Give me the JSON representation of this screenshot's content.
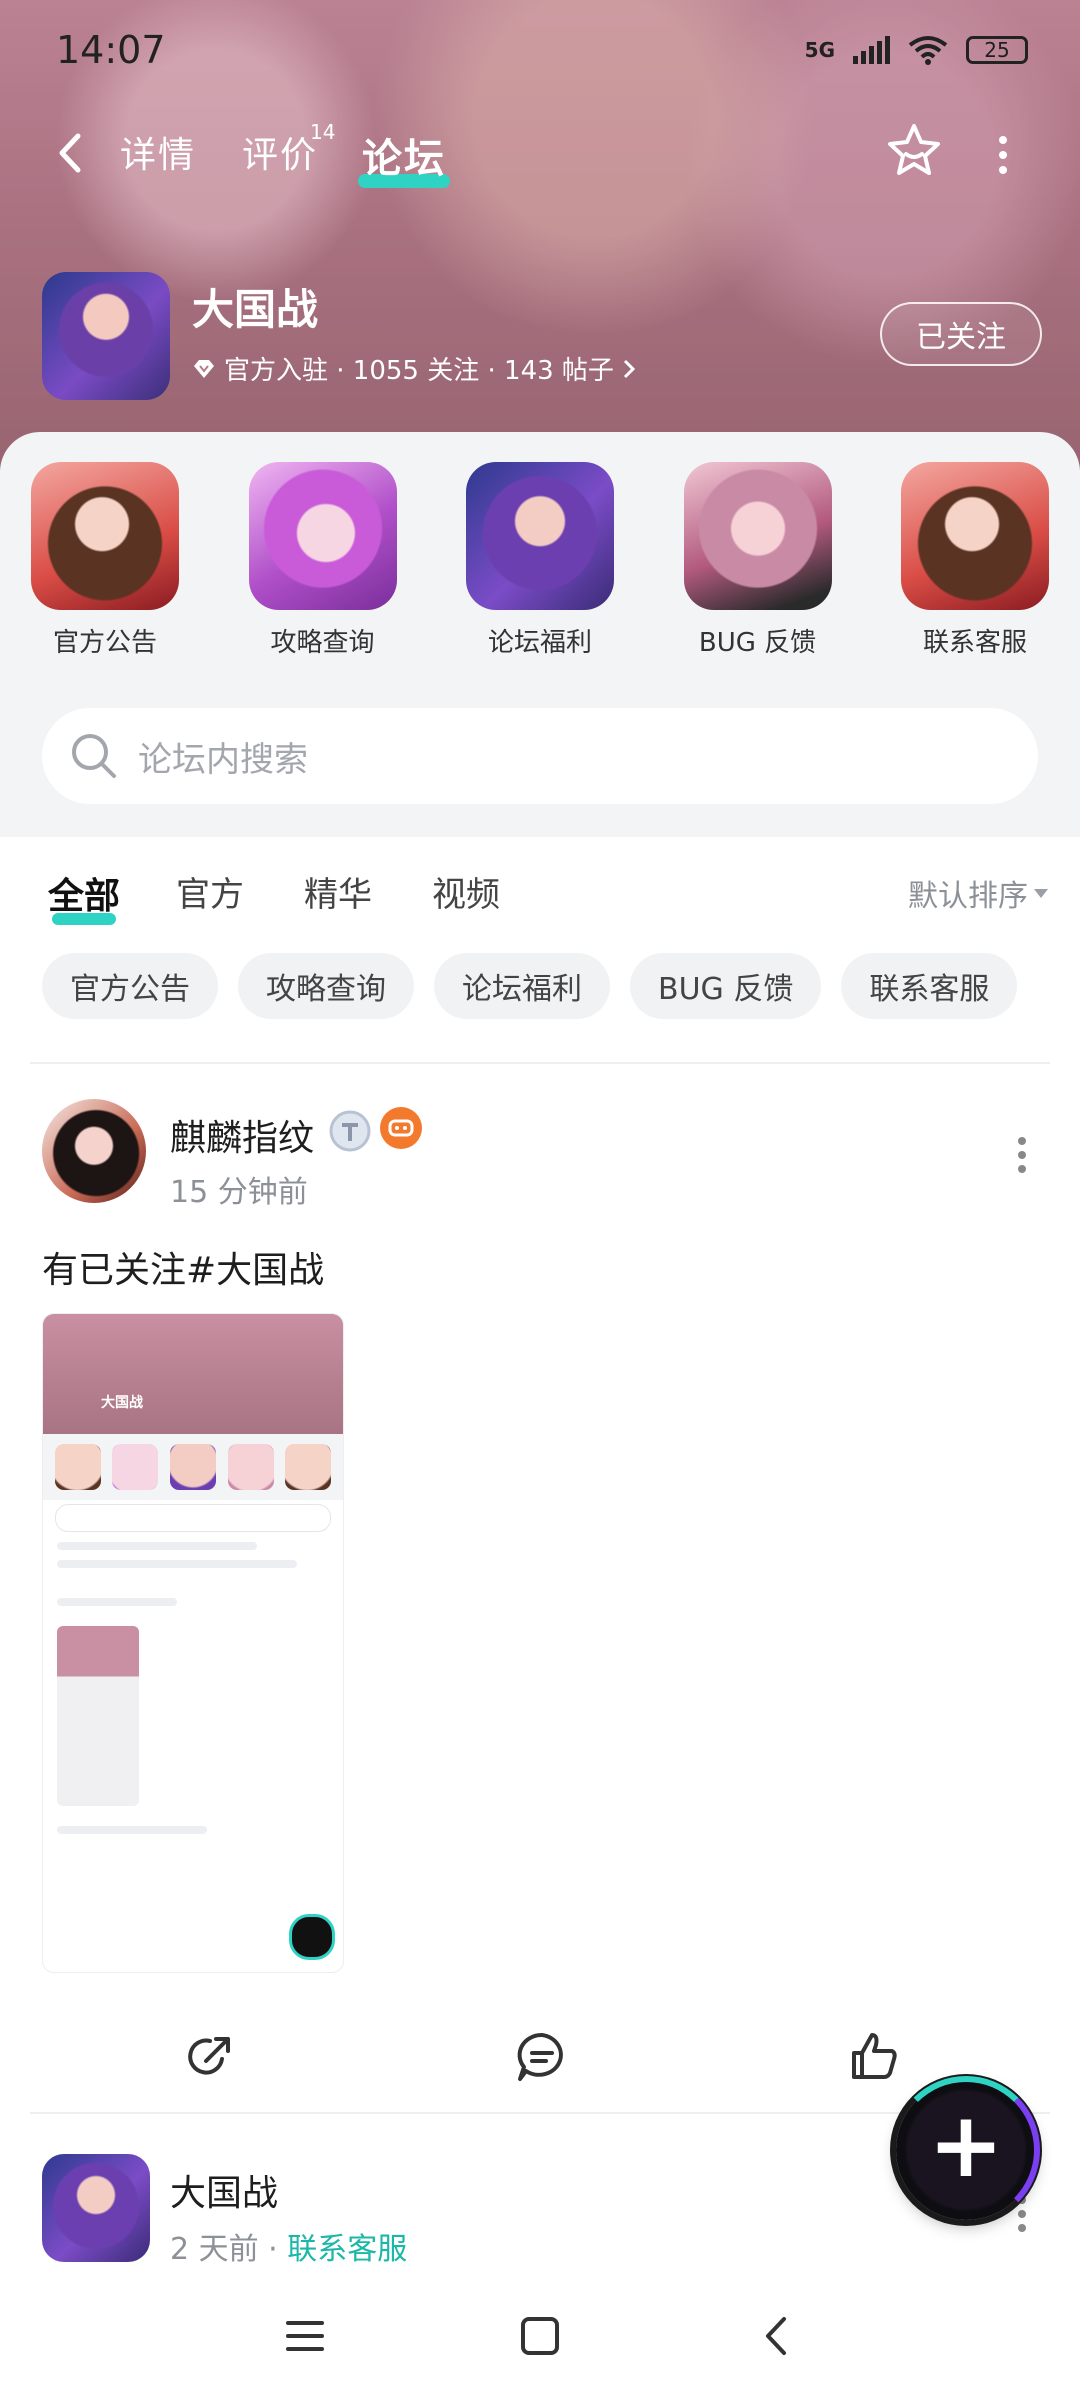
{
  "status": {
    "time": "14:07",
    "network": "5G",
    "battery": "25"
  },
  "header": {
    "tabs": [
      {
        "label": "详情"
      },
      {
        "label": "评价",
        "badge": "14"
      },
      {
        "label": "论坛"
      }
    ],
    "active_tab": "论坛"
  },
  "game": {
    "title": "大国战",
    "meta": "官方入驻 · 1055 关注 · 143 帖子",
    "follow_label": "已关注"
  },
  "categories": [
    {
      "label": "官方公告",
      "icon": "avatar-fox-girl"
    },
    {
      "label": "攻略查询",
      "icon": "avatar-pink-hair"
    },
    {
      "label": "论坛福利",
      "icon": "avatar-purple-hair"
    },
    {
      "label": "BUG 反馈",
      "icon": "avatar-lilac-hair"
    },
    {
      "label": "联系客服",
      "icon": "avatar-fox-girl"
    }
  ],
  "search": {
    "placeholder": "论坛内搜索"
  },
  "filter_tabs": [
    "全部",
    "官方",
    "精华",
    "视频"
  ],
  "sort_label": "默认排序",
  "chips": [
    "官方公告",
    "攻略查询",
    "论坛福利",
    "BUG 反馈",
    "联系客服"
  ],
  "post": {
    "user": "麒麟指纹",
    "time": "15 分钟前",
    "text": "有已关注#大国战",
    "thumbnail": {
      "title": "大国战"
    }
  },
  "post2": {
    "user": "大国战",
    "time": "2 天前 · ",
    "tag": "联系客服"
  },
  "colors": {
    "accent": "#2fd3c4",
    "tag": "#1bb8a8"
  }
}
